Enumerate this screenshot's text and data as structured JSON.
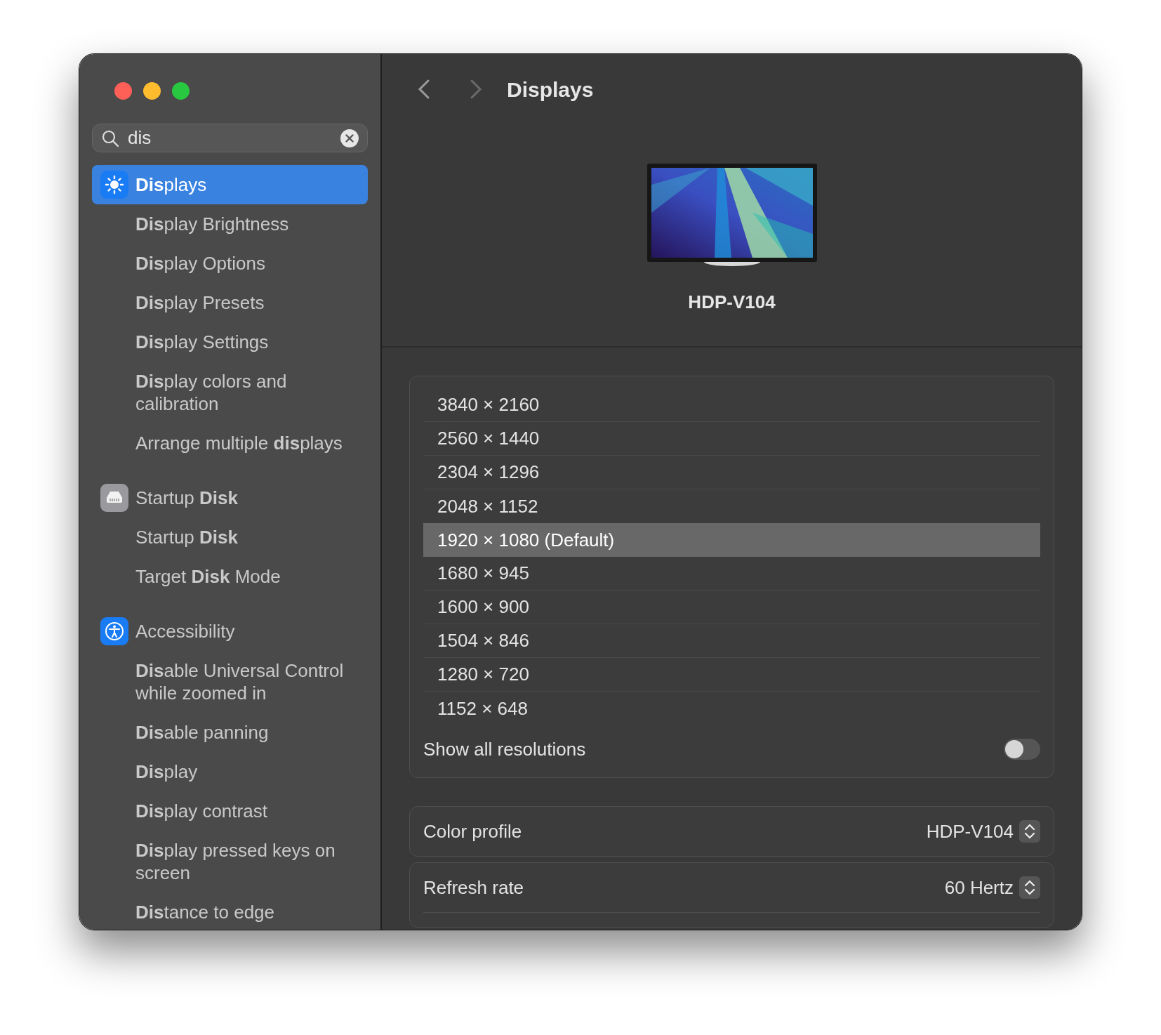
{
  "window": {
    "title": "Displays"
  },
  "search": {
    "value": "dis"
  },
  "sidebar": [
    {
      "title": "**Dis**plays",
      "selected": true,
      "items": [
        "**Dis**play Brightness",
        "**Dis**play Options",
        "**Dis**play Presets",
        "**Dis**play Settings",
        "**Dis**play colors and calibration",
        "Arrange multiple **dis**plays"
      ]
    },
    {
      "title": "Startup **Disk**",
      "selected": false,
      "items": [
        "Startup **Disk**",
        "Target **Disk** Mode"
      ]
    },
    {
      "title": "Accessibility",
      "selected": false,
      "items": [
        "**Dis**able Universal Control while zoomed in",
        "**Dis**able panning",
        "**Dis**play",
        "**Dis**play contrast",
        "**Dis**play pressed keys on screen",
        "**Dis**tance to edge"
      ]
    }
  ],
  "display": {
    "name": "HDP-V104"
  },
  "resolutions": [
    {
      "label": "3840 × 2160",
      "selected": false
    },
    {
      "label": "2560 × 1440",
      "selected": false
    },
    {
      "label": "2304 × 1296",
      "selected": false
    },
    {
      "label": "2048 × 1152",
      "selected": false
    },
    {
      "label": "1920 × 1080 (Default)",
      "selected": true
    },
    {
      "label": "1680 × 945",
      "selected": false
    },
    {
      "label": "1600 × 900",
      "selected": false
    },
    {
      "label": "1504 × 846",
      "selected": false
    },
    {
      "label": "1280 × 720",
      "selected": false
    },
    {
      "label": "1152 × 648",
      "selected": false
    }
  ],
  "show_all_resolutions": {
    "label": "Show all resolutions",
    "on": false
  },
  "settings": [
    {
      "label": "Color profile",
      "value": "HDP-V104"
    },
    {
      "label": "Refresh rate",
      "value": "60 Hertz"
    }
  ]
}
